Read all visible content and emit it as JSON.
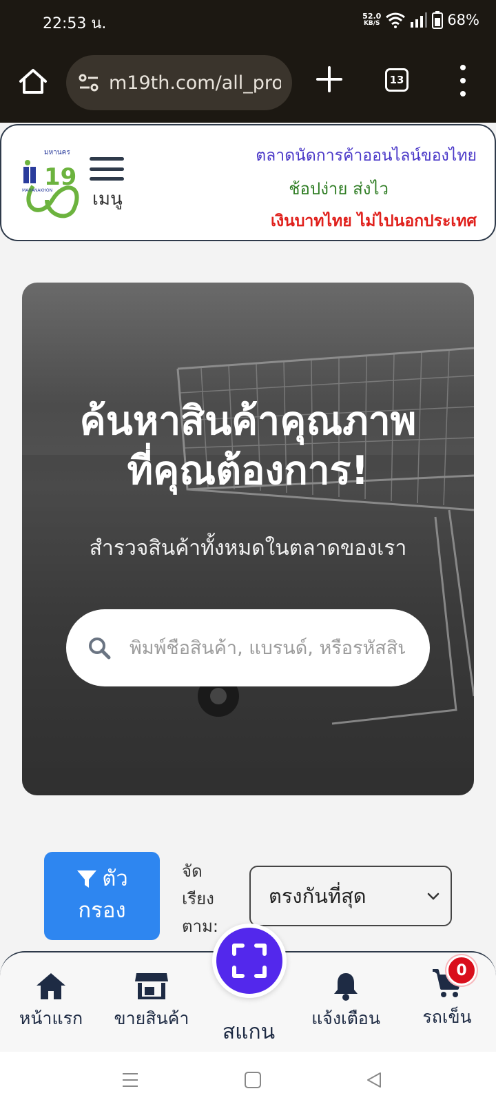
{
  "status_bar": {
    "time": "22:53 น.",
    "speed_value": "52.0",
    "speed_unit": "KB/S",
    "battery": "68%"
  },
  "browser": {
    "url": "m19th.com/all_pro",
    "tab_count": "13"
  },
  "header": {
    "logo_top_text": "มหานคร",
    "logo_number": "19",
    "logo_bottom_text": "MAHANAKHON",
    "menu_label": "เมนู",
    "tagline_1": "ตลาดนัดการค้าออนไลน์ของไทย",
    "tagline_2": "ช้อปง่าย ส่งไว",
    "tagline_3": "เงินบาทไทย ไม่ไปนอกประเทศ"
  },
  "hero": {
    "title_line_1": "ค้นหาสินค้าคุณภาพ",
    "title_line_2": "ที่คุณต้องการ!",
    "subtitle": "สำรวจสินค้าทั้งหมดในตลาดของเรา",
    "search_placeholder": "พิมพ์ชื่อสินค้า, แบรนด์, หรือรหัสสินค้า"
  },
  "filters": {
    "filter_label_1": "ตัว",
    "filter_label_2": "กรอง",
    "sort_label_1": "จัด",
    "sort_label_2": "เรียง",
    "sort_label_3": "ตาม:",
    "sort_selected": "ตรงกันที่สุด"
  },
  "bottom_nav": {
    "home": "หน้าแรก",
    "sell": "ขายสินค้า",
    "scan": "สแกน",
    "notifications": "แจ้งเตือน",
    "cart": "รถเข็น",
    "cart_count": "0"
  },
  "colors": {
    "accent_blue": "#2e86f0",
    "scan_purple": "#5328ec",
    "badge_red": "#d90f1c",
    "nav_dark": "#1e2b44"
  }
}
